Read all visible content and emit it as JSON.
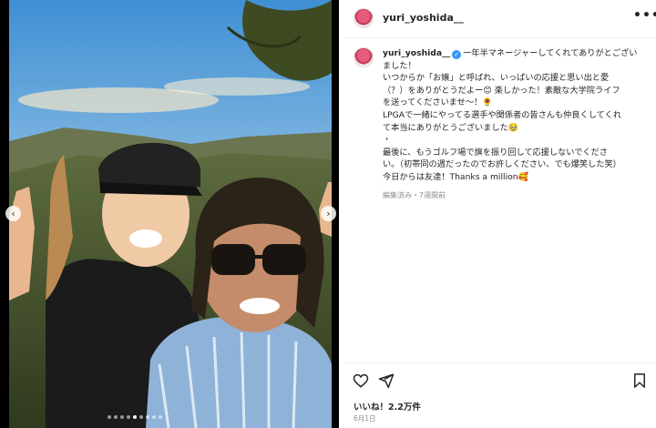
{
  "post": {
    "username": "yuri_yoshida__",
    "more_label": "•••",
    "caption_lines": [
      "一年半マネージャーしてくれてありがとござい",
      "ました！",
      "いつからか「お嬢」と呼ばれ、いっぱいの応援と思い出と愛",
      "（？）をありがとうだよー😊 楽しかった！素敵な大学院ライフ",
      "を送ってくださいませ〜！🌻",
      "LPGAで一緒にやってる選手や関係者の皆さんも仲良くしてくれ",
      "て本当にありがとうございました🥹",
      "・",
      "最後に、もうゴルフ場で旗を振り回して応援しないでくださ",
      "い。（初帯同の週だったのでお許しください、でも爆笑した笑）",
      "今日からは友達！Thanks a million🥰"
    ],
    "meta": "編集済み・7週間前",
    "likes": "いいね！2.2万件",
    "date": "6月1日"
  },
  "icons": {
    "verified": "verified-badge-icon",
    "heart": "heart-icon",
    "share": "send-icon",
    "bookmark": "bookmark-icon",
    "prev": "chevron-left-icon",
    "next": "chevron-right-icon"
  },
  "colors": {
    "verified": "#3897f0",
    "text": "#262626",
    "muted": "#8e8e8e"
  }
}
